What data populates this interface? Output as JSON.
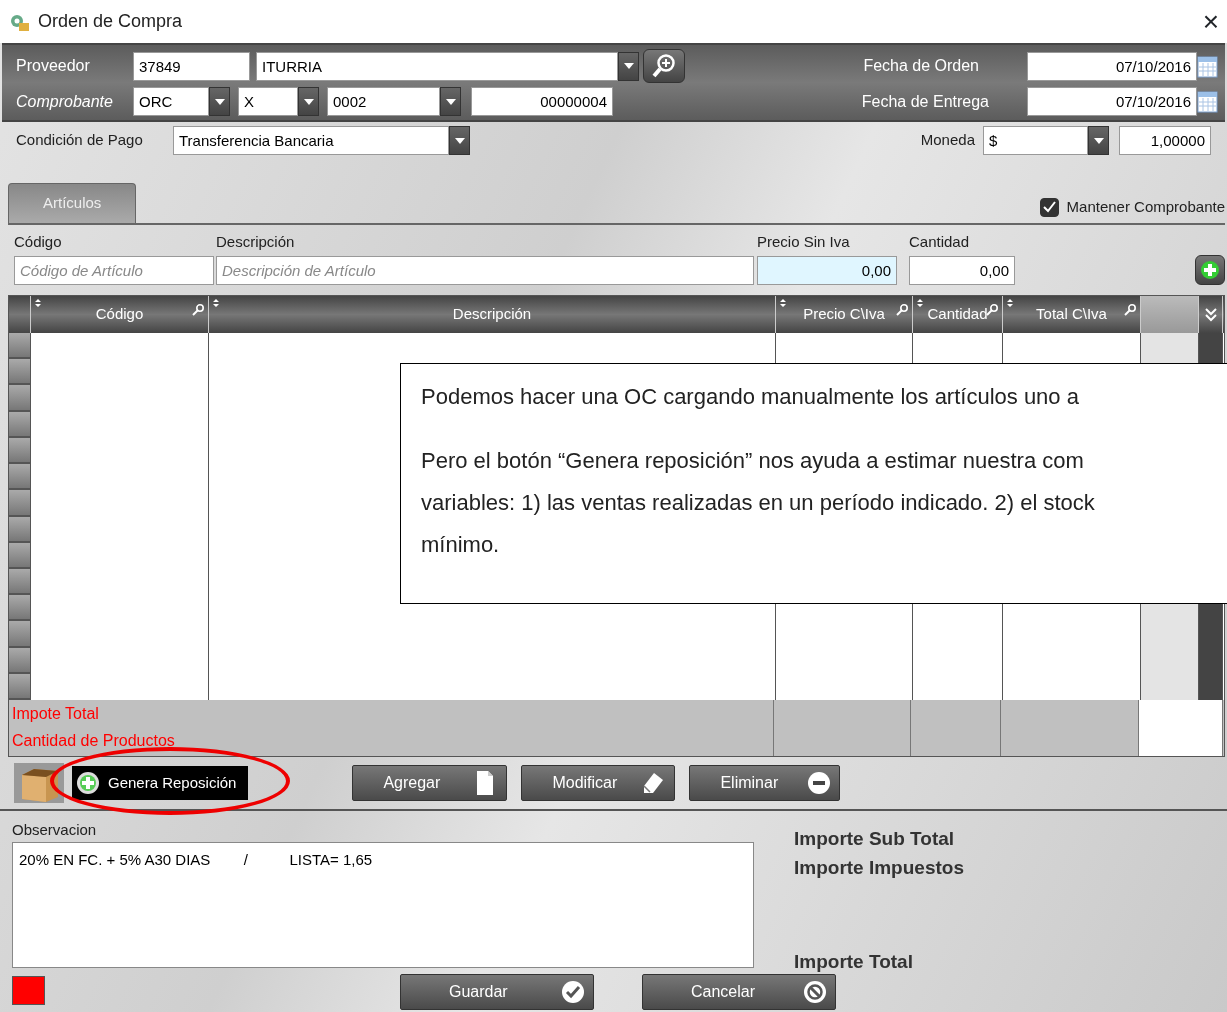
{
  "window": {
    "title": "Orden de Compra",
    "close": "×"
  },
  "proveedor": {
    "label": "Proveedor",
    "code": "37849",
    "name": "ITURRIA"
  },
  "comprobante": {
    "label": "Comprobante",
    "type": "ORC",
    "letter": "X",
    "point": "0002",
    "number": "00000004"
  },
  "fecha_orden": {
    "label": "Fecha de Orden",
    "value": "07/10/2016"
  },
  "fecha_entrega": {
    "label": "Fecha de Entrega",
    "value": "07/10/2016"
  },
  "condicion_pago": {
    "label": "Condición de Pago",
    "value": "Transferencia Bancaria"
  },
  "moneda": {
    "label": "Moneda",
    "value": "$",
    "rate": "1,00000"
  },
  "tabs": [
    {
      "label": "Artículos",
      "selected": true
    }
  ],
  "mantener": {
    "label": "Mantener Comprobante",
    "checked": true
  },
  "entry": [
    {
      "label": "Código",
      "placeholder": "Código de Artículo"
    },
    {
      "label": "Descripción",
      "placeholder": "Descripción de Artículo"
    },
    {
      "label": "Precio Sin Iva",
      "value": "0,00"
    },
    {
      "label": "Cantidad",
      "value": "0,00"
    }
  ],
  "grid": {
    "columns": [
      {
        "label": "Código",
        "search": true
      },
      {
        "label": "Descripción",
        "search": false
      },
      {
        "label": "Precio C\\Iva",
        "search": true
      },
      {
        "label": "Cantidad",
        "search": true
      },
      {
        "label": "Total C\\Iva",
        "search": true
      }
    ],
    "summary": [
      "Impote Total",
      "Cantidad de Productos"
    ]
  },
  "callout": {
    "paragraphs": [
      [
        "Podemos hacer una OC cargando manualmente los artículos uno a"
      ],
      [
        "Pero el botón “Genera reposición” nos ayuda a estimar nuestra com",
        "variables: 1) las ventas realizadas en un período indicado. 2) el stock",
        "mínimo."
      ]
    ]
  },
  "generate_button": {
    "label": "Genera Reposición",
    "highlighted": true
  },
  "actions": [
    {
      "label": "Agregar",
      "kind": "add"
    },
    {
      "label": "Modificar",
      "kind": "edit"
    },
    {
      "label": "Eliminar",
      "kind": "remove"
    }
  ],
  "observacion": {
    "label": "Observacion",
    "value": "20% EN FC. + 5% A30 DIAS        /          LISTA= 1,65"
  },
  "totals": [
    "Importe Sub Total",
    "Importe Impuestos",
    "Importe Total"
  ],
  "footer_buttons": [
    {
      "label": "Guardar",
      "kind": "save"
    },
    {
      "label": "Cancelar",
      "kind": "cancel"
    }
  ]
}
